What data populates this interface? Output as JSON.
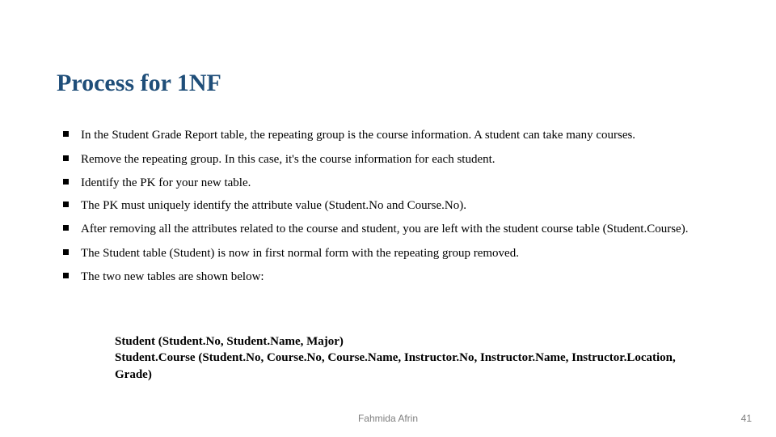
{
  "title": "Process for 1NF",
  "bullets": [
    "In the Student Grade Report table, the repeating group is the course information. A student can take many courses.",
    "Remove the repeating group. In this case, it's the course information for each student.",
    "Identify the PK for your new table.",
    "The PK must uniquely identify the attribute value (Student.No and Course.No).",
    "After removing all the attributes related to the course and student, you are left with the student course table (Student.Course).",
    "The Student table (Student) is now in first normal form with the repeating group removed.",
    "The two new tables are shown below:"
  ],
  "schema_lines": [
    "Student (Student.No, Student.Name, Major)",
    "Student.Course (Student.No, Course.No, Course.Name, Instructor.No, Instructor.Name, Instructor.Location, Grade)"
  ],
  "footer": {
    "author": "Fahmida Afrin",
    "page": "41"
  }
}
